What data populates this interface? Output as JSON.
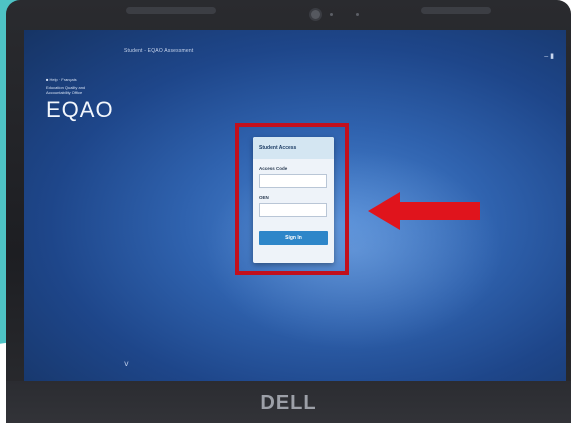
{
  "screen": {
    "window_title": "Student - EQAO Assessment",
    "window_controls": "– ▮"
  },
  "branding": {
    "links": "■  Help · Français",
    "subtitle": "Education Quality and Accountability Office",
    "logo_text": "EQAO"
  },
  "login": {
    "header": "Student Access",
    "access_code_label": "Access Code",
    "access_code_value": "",
    "oen_label": "OEN",
    "oen_value": "",
    "sign_in_label": "Sign In"
  },
  "laptop": {
    "brand": "DELL"
  },
  "colors": {
    "highlight_border": "#c2101d",
    "arrow": "#e0141c",
    "button": "#2e86c9",
    "teal_background": "#4ec3c5"
  }
}
